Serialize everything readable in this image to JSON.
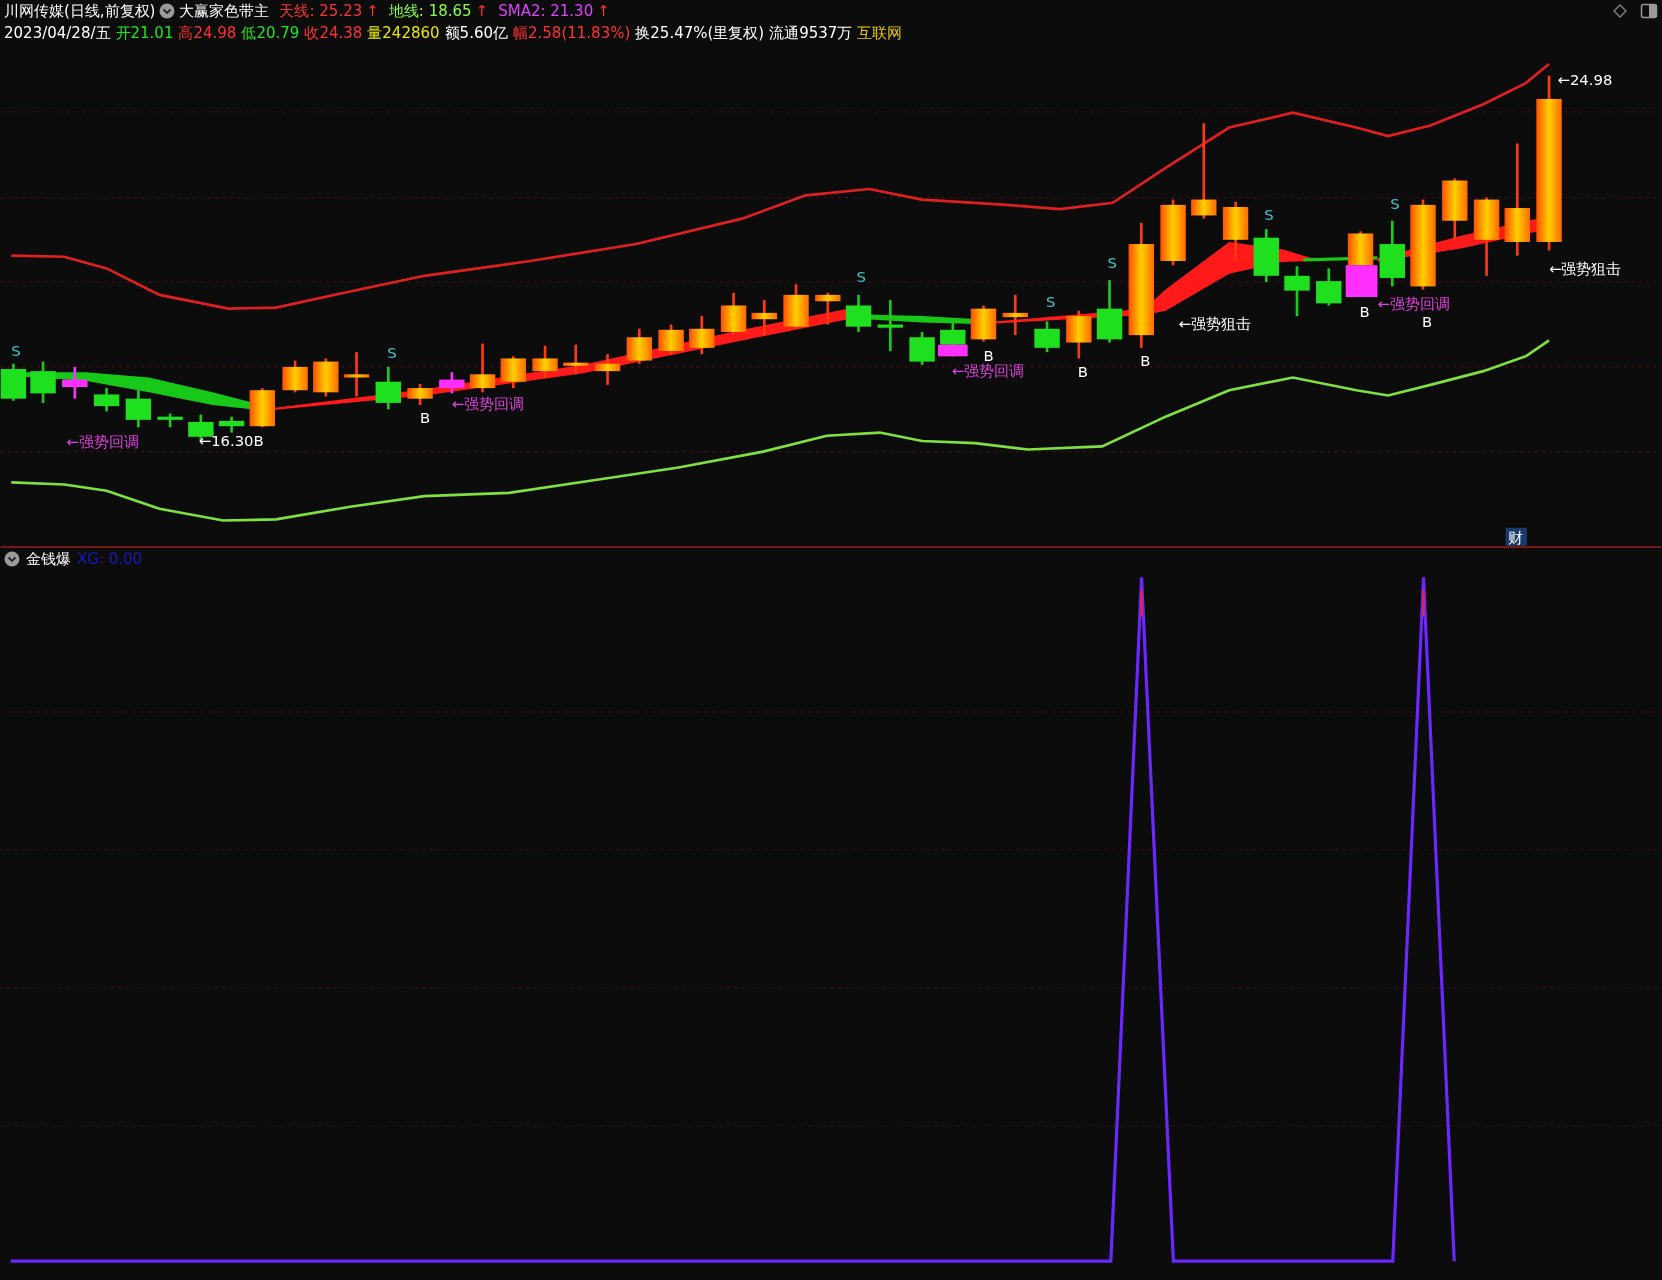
{
  "quote_header": {
    "stock_title": "川网传媒(日线,前复权)",
    "indicator_name": "大赢家色带主",
    "indicator_values": [
      {
        "label": "天线: 25.23",
        "arrow": "↑",
        "color": "#ff3232"
      },
      {
        "label": "地线: 18.65",
        "arrow": "↑",
        "color": "#88ff44"
      },
      {
        "label": "SMA2: 21.30",
        "arrow": "↑",
        "color": "#e040ff"
      }
    ]
  },
  "quote_details": [
    {
      "text": "2023/04/28/五",
      "color": "#ffffff"
    },
    {
      "text": "开21.01",
      "color": "#22e022"
    },
    {
      "text": "高24.98",
      "color": "#ff3232"
    },
    {
      "text": "低20.79",
      "color": "#22e022"
    },
    {
      "text": "收24.38",
      "color": "#ff3232"
    },
    {
      "text": "量242860",
      "color": "#e8e800"
    },
    {
      "text": "额5.60亿",
      "color": "#ffffff"
    },
    {
      "text": "幅2.58(11.83%)",
      "color": "#ff3232"
    },
    {
      "text": "换25.47%(里复权)",
      "color": "#ffffff"
    },
    {
      "text": "流通9537万",
      "color": "#ffffff"
    },
    {
      "text": "互联网",
      "color": "#e8c800"
    }
  ],
  "main_chart": {
    "annotations": [
      {
        "kind": "sell",
        "text": "S"
      },
      {
        "kind": "retrace",
        "text": "←强势回调"
      },
      {
        "kind": "price",
        "text": "←16.30B"
      },
      {
        "kind": "sell",
        "text": "S"
      },
      {
        "kind": "buy",
        "text": "B"
      },
      {
        "kind": "retrace",
        "text": "←强势回调"
      },
      {
        "kind": "sell",
        "text": "S"
      },
      {
        "kind": "retrace",
        "text": "←强势回调"
      },
      {
        "kind": "buy",
        "text": "B"
      },
      {
        "kind": "sell",
        "text": "S"
      },
      {
        "kind": "buy",
        "text": "B"
      },
      {
        "kind": "sell",
        "text": "S"
      },
      {
        "kind": "buy",
        "text": "B"
      },
      {
        "kind": "strike",
        "text": "←强势狙击"
      },
      {
        "kind": "sell",
        "text": "S"
      },
      {
        "kind": "retrace",
        "text": "←强势回调"
      },
      {
        "kind": "buy",
        "text": "B"
      },
      {
        "kind": "sell",
        "text": "S"
      },
      {
        "kind": "buy",
        "text": "B"
      },
      {
        "kind": "strike",
        "text": "←强势狙击"
      },
      {
        "kind": "price",
        "text": "←24.98"
      }
    ],
    "badge": "财"
  },
  "sub_panel": {
    "title": "金钱爆",
    "value_label": "XG: 0.00"
  }
}
